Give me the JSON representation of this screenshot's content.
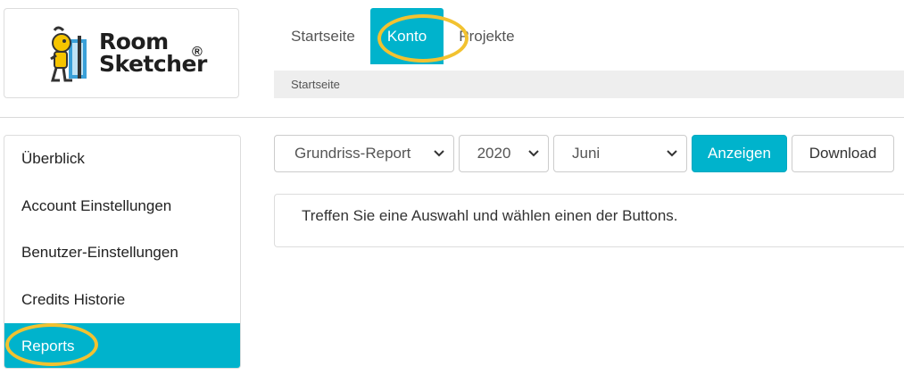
{
  "logo": {
    "line1": "Room",
    "line2": "Sketcher",
    "registered": "®",
    "icon": "roomsketcher-mascot-icon"
  },
  "topnav": {
    "tabs": [
      {
        "label": "Startseite",
        "active": false
      },
      {
        "label": "Konto",
        "active": true,
        "highlighted": true
      },
      {
        "label": "Projekte",
        "active": false
      }
    ]
  },
  "breadcrumb": {
    "label": "Startseite"
  },
  "sidebar": {
    "items": [
      {
        "label": "Überblick",
        "active": false
      },
      {
        "label": "Account Einstellungen",
        "active": false
      },
      {
        "label": "Benutzer-Einstellungen",
        "active": false
      },
      {
        "label": "Credits Historie",
        "active": false
      },
      {
        "label": "Reports",
        "active": true,
        "highlighted": true
      }
    ]
  },
  "controls": {
    "report_type": {
      "selected": "Grundriss-Report"
    },
    "year": {
      "selected": "2020"
    },
    "month": {
      "selected": "Juni"
    },
    "show_button": "Anzeigen",
    "download_button": "Download"
  },
  "info": {
    "message": "Treffen Sie eine Auswahl und wählen einen der Buttons."
  },
  "colors": {
    "accent": "#00b3cc",
    "highlight": "#f2c230"
  }
}
